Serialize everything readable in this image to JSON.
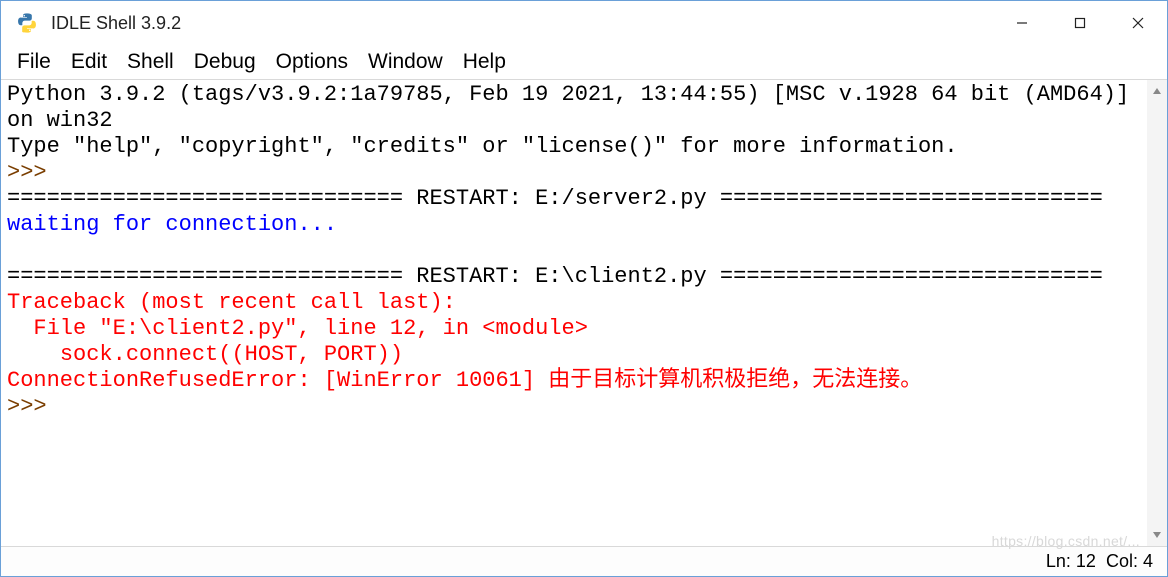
{
  "window": {
    "title": "IDLE Shell 3.9.2"
  },
  "menu": {
    "items": [
      "File",
      "Edit",
      "Shell",
      "Debug",
      "Options",
      "Window",
      "Help"
    ]
  },
  "content": {
    "banner_line1": "Python 3.9.2 (tags/v3.9.2:1a79785, Feb 19 2021, 13:44:55) [MSC v.1928 64 bit (AMD64)] on win32",
    "banner_line2": "Type \"help\", \"copyright\", \"credits\" or \"license()\" for more information.",
    "prompt": ">>> ",
    "restart1": "============================== RESTART: E:/server2.py =============================",
    "stdout1": "waiting for connection...",
    "blank": "",
    "restart2": "============================== RESTART: E:\\client2.py =============================",
    "tb1": "Traceback (most recent call last):",
    "tb2": "  File \"E:\\client2.py\", line 12, in <module>",
    "tb3": "    sock.connect((HOST, PORT))",
    "tb4": "ConnectionRefusedError: [WinError 10061] 由于目标计算机积极拒绝，无法连接。",
    "prompt2": ">>> "
  },
  "status": {
    "ln_label": "Ln:",
    "ln_value": "12",
    "col_label": "Col:",
    "col_value": "4"
  },
  "watermark": "https://blog.csdn.net/..."
}
